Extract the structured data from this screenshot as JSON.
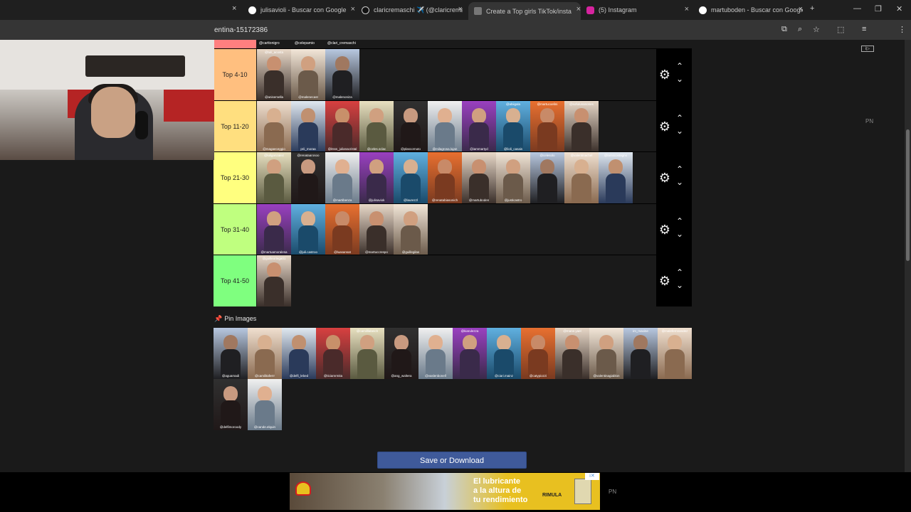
{
  "browser": {
    "tabs": [
      {
        "title": "julisavioli - Buscar con Google",
        "icon": "google-icon",
        "active": false
      },
      {
        "title": "claricremaschi ✈️ (@claricremaschi)",
        "icon": "tiktok-icon",
        "active": false
      },
      {
        "title": "Create a Top girls TikTok/insta",
        "icon": "tiermaker-icon",
        "active": true
      },
      {
        "title": "(5) Instagram",
        "icon": "instagram-icon",
        "active": false
      },
      {
        "title": "martuboden - Buscar con Google",
        "icon": "google-icon",
        "active": false
      }
    ],
    "first_tab_close": "×",
    "new_tab": "+",
    "window_controls": {
      "minimize": "—",
      "maximize": "❐",
      "close": "✕"
    },
    "url_fragment": "entina-15172386",
    "profile_initial": "F"
  },
  "tiers": [
    {
      "label": "Top 4-10",
      "color": "#ffbf7f",
      "items": [
        {
          "top": "@tuli_acosta",
          "bottom": "@anisemella"
        },
        {
          "top": "",
          "bottom": "@malenecast"
        },
        {
          "top": "",
          "bottom": "@malenoniza"
        }
      ]
    },
    {
      "label": "Top 11-20",
      "color": "#ffdf7f",
      "items": [
        {
          "top": "",
          "bottom": "@magaeceggio"
        },
        {
          "top": "",
          "bottom": "prii_moraa"
        },
        {
          "top": "",
          "bottom": "@itsss_julianacristal"
        },
        {
          "top": "",
          "bottom": "@celes.sclac"
        },
        {
          "top": "",
          "bottom": "@plascornuto"
        },
        {
          "top": "",
          "bottom": "@milagrosa.lujan"
        },
        {
          "top": "",
          "bottom": "@iammartyd"
        },
        {
          "top": "@abiigala",
          "bottom": "@lioli_casais"
        },
        {
          "top": "@martucoelini",
          "bottom": ""
        },
        {
          "top": "@sofulunanones",
          "bottom": ""
        }
      ]
    },
    {
      "label": "Top 21-30",
      "color": "#ffff7f",
      "items": [
        {
          "top": "@luligonzalez",
          "bottom": ""
        },
        {
          "top": "@renataarosoo",
          "bottom": ""
        },
        {
          "top": "",
          "bottom": "@martibenza"
        },
        {
          "top": "",
          "bottom": "@julisaviok"
        },
        {
          "top": "",
          "bottom": "@laurezzl"
        },
        {
          "top": "",
          "bottom": "@renatabiasonich"
        },
        {
          "top": "",
          "bottom": "@martuboden"
        },
        {
          "top": "",
          "bottom": "@justicastro"
        },
        {
          "top": "@celesolo",
          "bottom": ""
        },
        {
          "top": "@valentinachel",
          "bottom": ""
        },
        {
          "top": "@larsscostagno",
          "bottom": ""
        }
      ]
    },
    {
      "label": "Top 31-40",
      "color": "#bfff7f",
      "items": [
        {
          "top": "",
          "bottom": "@martuamoralesa"
        },
        {
          "top": "",
          "bottom": "@juli.castroo"
        },
        {
          "top": "",
          "bottom": "@luasansat"
        },
        {
          "top": "",
          "bottom": "@martuccrespo"
        },
        {
          "top": "",
          "bottom": "@guillegilas"
        }
      ]
    },
    {
      "label": "Top 41-50",
      "color": "#7fff7f",
      "items": [
        {
          "top": "@guilleortega01",
          "bottom": ""
        }
      ]
    }
  ],
  "top_strip_tags": [
    "@carttonigro",
    "@celepamio",
    "@clari_cremaschi"
  ],
  "pin_images": {
    "title": "Pin Images",
    "rows": [
      [
        {
          "top": "",
          "bottom": "@aguamadi"
        },
        {
          "top": "",
          "bottom": "@camilitaferrr"
        },
        {
          "top": "",
          "bottom": "@delfi_lebed"
        },
        {
          "top": "",
          "bottom": "@ticiamrmita"
        },
        {
          "top": "@camilllabeich",
          "bottom": ""
        },
        {
          "top": "",
          "bottom": "@ang_waltera"
        },
        {
          "top": "",
          "bottom": "@vaslenbonell"
        },
        {
          "top": "@kiarulezza",
          "bottom": ""
        },
        {
          "top": "",
          "bottom": "@ciari.mainz"
        },
        {
          "top": "",
          "bottom": "@catypiozzi"
        },
        {
          "top": "@mane.yael",
          "bottom": ""
        },
        {
          "top": "",
          "bottom": "@valentinagiablon"
        },
        {
          "top": "im_maxine",
          "bottom": ""
        },
        {
          "top": "@malefernnandez",
          "bottom": ""
        }
      ],
      [
        {
          "top": "",
          "bottom": "@delfimoroody"
        },
        {
          "top": "",
          "bottom": "@cande.elquin"
        }
      ]
    ]
  },
  "save_button": "Save or Download",
  "ad": {
    "headline_1": "El lubricante",
    "headline_2": "a la altura de",
    "headline_3": "tu rendimiento",
    "brand": "RIMULA",
    "badge": "PN"
  },
  "side_badge": "PN",
  "colors": {
    "accent_button": "#3f5a9a",
    "tier_top": "#ff7f7f"
  }
}
